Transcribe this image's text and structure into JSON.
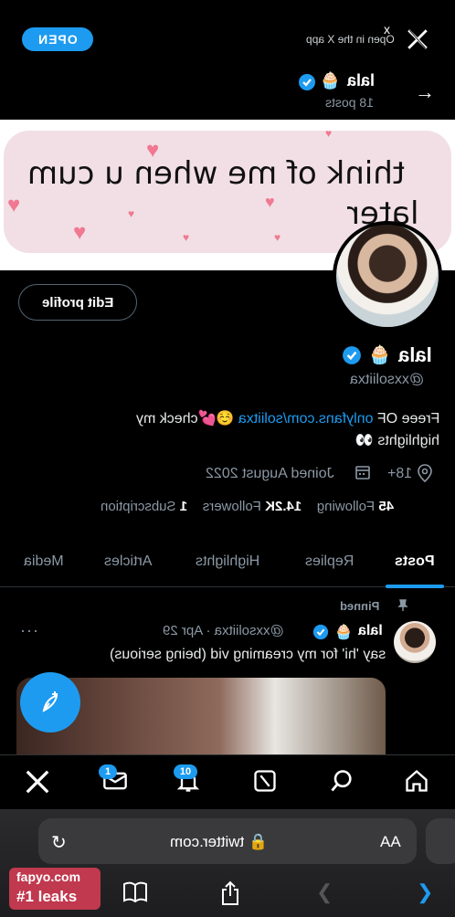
{
  "banner_prompt": {
    "open_button": "OPEN",
    "open_text": "Open in the X app",
    "close_label": "x"
  },
  "header": {
    "name": "lala",
    "emoji": "🧁",
    "posts": "18 posts"
  },
  "banner": {
    "line1": "think of me when u cum",
    "line2": "later"
  },
  "profile": {
    "edit_button": "Edit profile",
    "name": "lala",
    "emoji": "🧁",
    "handle": "@xxsoliitxa",
    "bio_prefix": "Freee OF ",
    "bio_link": "onlyfans.com/soliitxa",
    "bio_suffix": " ☺️💕check my",
    "bio_line2": "highlights 👀",
    "age": "18+",
    "joined": "Joined August 2022",
    "following_count": "45",
    "following_label": "Following",
    "followers_count": "14.2K",
    "followers_label": "Followers",
    "subscription_count": "1",
    "subscription_label": "Subscription"
  },
  "tabs": [
    "Posts",
    "Replies",
    "Highlights",
    "Articles",
    "Media"
  ],
  "post": {
    "pinned": "Pinned",
    "name": "lala",
    "emoji": "🧁",
    "meta": "@xxsoliitxa · Apr 29",
    "more": "···",
    "text": "say 'hi' for my creaming vid (being serious)"
  },
  "bottom_nav": {
    "messages_badge": "1",
    "notifications_badge": "10"
  },
  "safari": {
    "url": "twitter.com",
    "aa": "AA"
  },
  "watermark": {
    "top": "fapyo.com",
    "bottom": "#1 leaks"
  },
  "colors": {
    "accent": "#1d9bf0",
    "background": "#000000",
    "muted": "#8b98a5"
  }
}
